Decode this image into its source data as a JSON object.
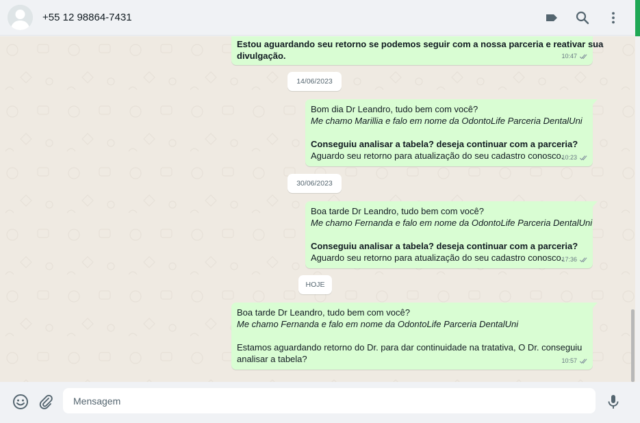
{
  "header": {
    "contact_name": "+55 12 98864-7431",
    "icons": [
      "label-icon",
      "search-icon",
      "menu-icon"
    ]
  },
  "chat": {
    "messages": [
      {
        "lines": [
          "Estou aguardando seu retorno se podemos seguir com a nossa parceria e reativar sua",
          "divulgação."
        ],
        "time": "10:47",
        "status": "read"
      },
      {
        "date": "14/06/2023"
      },
      {
        "lines": [
          "Bom dia Dr Leandro, tudo bem com você?",
          "Me chamo Marillia e falo em nome da OdontoLife Parceria DentalUni",
          "",
          "Conseguiu analisar a tabela? deseja continuar com a parceria?",
          "Aguardo seu retorno para atualização do seu cadastro conosco."
        ],
        "time": "10:23",
        "status": "read"
      },
      {
        "date": "30/06/2023"
      },
      {
        "lines": [
          "Boa tarde Dr Leandro, tudo bem com você?",
          "Me chamo Fernanda e falo em nome da OdontoLife Parceria DentalUni",
          "",
          "Conseguiu analisar a tabela? deseja continuar com a parceria?",
          "Aguardo seu retorno para atualização do seu cadastro conosco."
        ],
        "time": "17:36",
        "status": "read"
      },
      {
        "date": "HOJE"
      },
      {
        "lines": [
          "Boa tarde Dr Leandro, tudo bem com você?",
          "Me chamo Fernanda e falo em nome da OdontoLife Parceria DentalUni",
          "",
          "Estamos aguardando retorno do Dr. para dar continuidade na tratativa, O Dr. conseguiu",
          "analisar a tabela?"
        ],
        "time": "10:57",
        "status": "read"
      }
    ]
  },
  "composer": {
    "placeholder": "Mensagem",
    "value": "",
    "icons": [
      "emoji-icon",
      "attach-icon",
      "microphone-icon"
    ]
  },
  "colors": {
    "outgoing_bubble": "#d9fdd3",
    "chat_background": "#efeae2",
    "panel": "#f0f2f5",
    "accent": "#1fa855",
    "read_ticks": "#8696a0"
  }
}
